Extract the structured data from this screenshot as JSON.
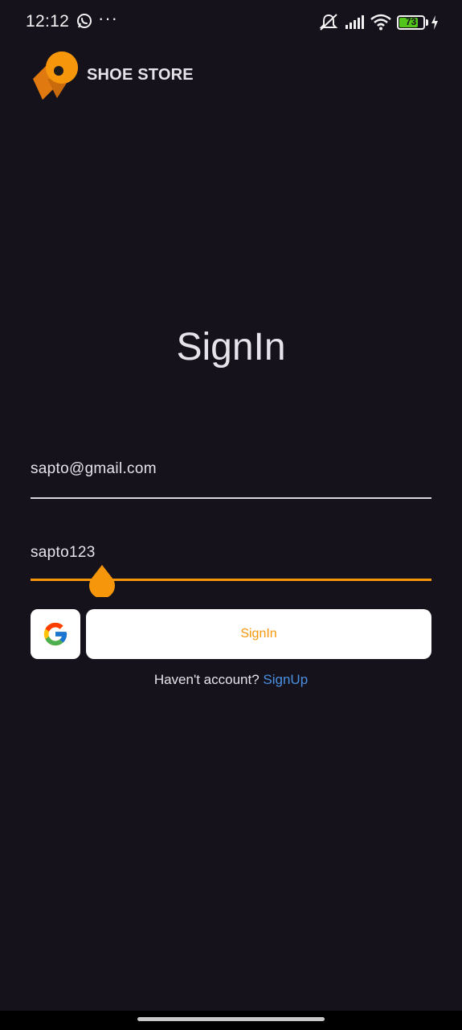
{
  "status_bar": {
    "time": "12:12",
    "more": "···",
    "battery_level": "73",
    "battery_color": "#52c41a",
    "icons": [
      "whatsapp-icon",
      "more-icon",
      "mute-icon",
      "signal-icon",
      "wifi-icon",
      "battery-icon",
      "charging-icon"
    ]
  },
  "header": {
    "brand_name": "SHOE STORE",
    "logo_icon": "location-pin-logo"
  },
  "signin": {
    "title": "SignIn",
    "email_value": "sapto@gmail.com",
    "password_value": "sapto123",
    "google_icon": "google-icon",
    "button_label": "SignIn",
    "prompt_text": "Haven't account?",
    "signup_link": "SignUp"
  },
  "colors": {
    "background": "#15121b",
    "accent": "#f6960a",
    "link": "#4a90e2",
    "text": "#e6e4ea"
  }
}
